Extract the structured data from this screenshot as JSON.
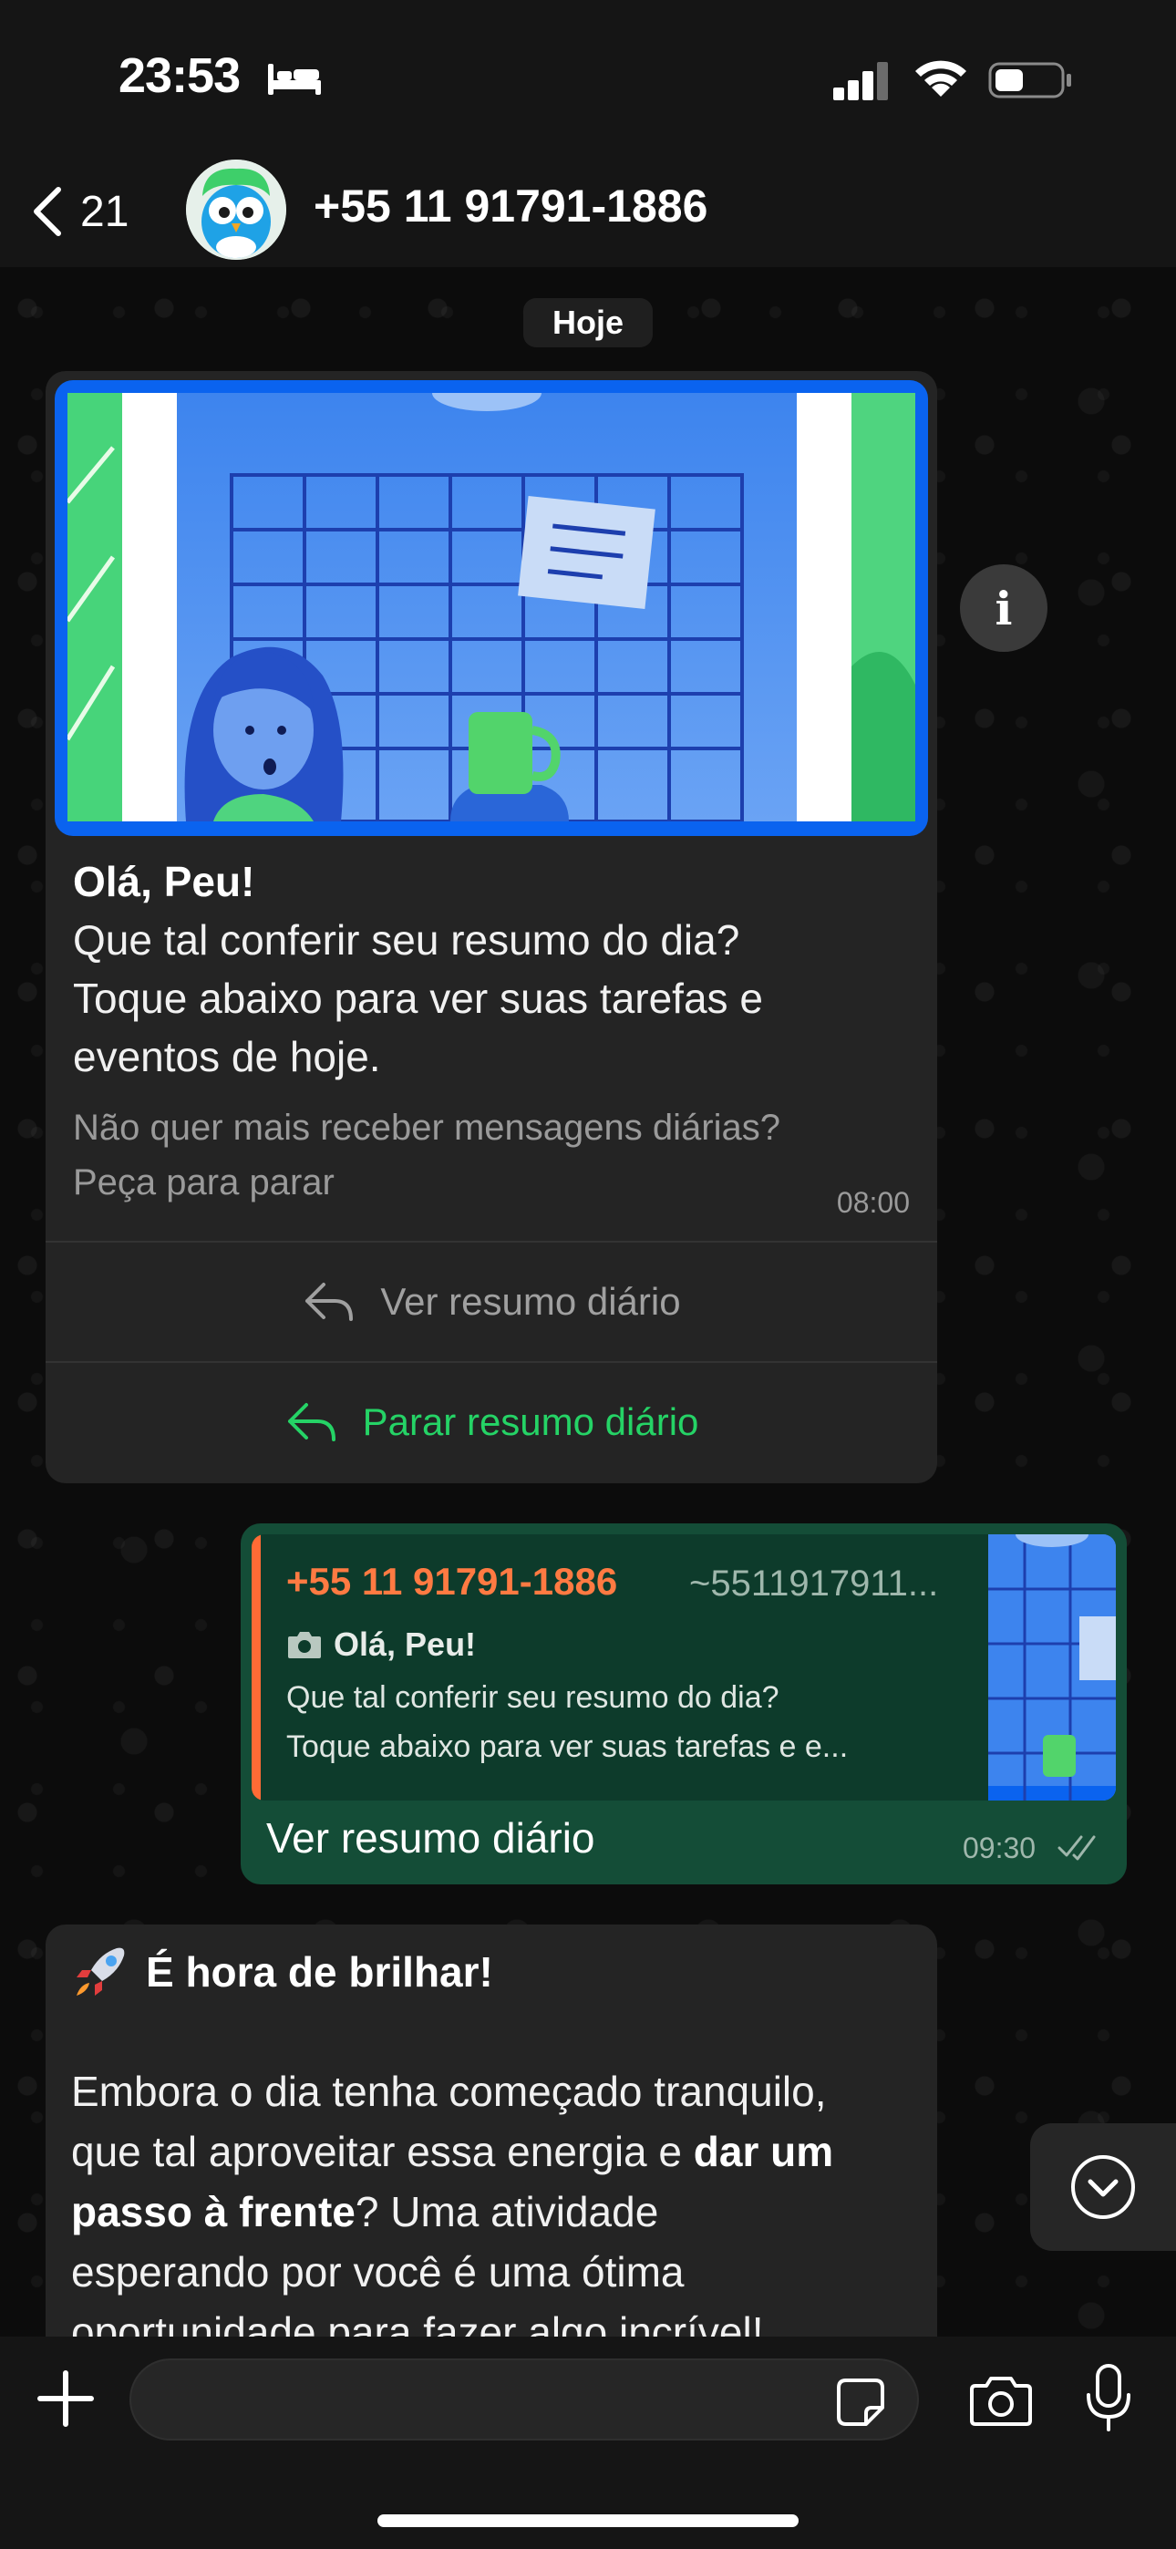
{
  "status_bar": {
    "time": "23:53",
    "icons": [
      "bed-icon",
      "signal-icon",
      "wifi-icon",
      "battery-icon"
    ]
  },
  "header": {
    "back_count": "21",
    "contact_name": "+55 11 91791-1886",
    "icons": [
      "chevron-left-icon",
      "avatar"
    ]
  },
  "chat": {
    "date_label": "Hoje",
    "template_message": {
      "greeting": "Olá, Peu!",
      "body_lines": [
        "Que tal conferir seu resumo do dia?",
        "Toque abaixo para ver suas tarefas e",
        "eventos de hoje."
      ],
      "footer_lines": [
        "Não quer mais receber mensagens diárias?",
        "Peça para parar"
      ],
      "time": "08:00",
      "buttons": [
        {
          "label": "Ver resumo diário",
          "color": "#a0a0a0"
        },
        {
          "label": "Parar resumo diário",
          "color": "#25d366"
        }
      ]
    },
    "reply_message": {
      "quote_sender": "+55 11 91791-1886",
      "quote_alias": "~5511917911...",
      "quote_title": "Olá, Peu!",
      "quote_lines": [
        "Que tal conferir seu resumo do dia?",
        "Toque abaixo para ver suas tarefas e e..."
      ],
      "text": "Ver resumo diário",
      "time": "09:30",
      "status": "read"
    },
    "third_message": {
      "title": "É hora de brilhar!",
      "lines": [
        "Embora o dia tenha começado tranquilo,",
        "que tal aproveitar essa energia e ",
        "dar um",
        "passo à frente",
        "? Uma atividade",
        "esperando por você é uma ótima",
        "oportunidade para fazer algo incrível!"
      ]
    }
  },
  "input_bar": {
    "placeholder": "",
    "icons": [
      "plus-icon",
      "sticker-icon",
      "camera-icon",
      "mic-icon"
    ]
  },
  "colors": {
    "accent_green": "#25d366",
    "outgoing_bubble": "#144d37",
    "incoming_bubble": "#242424",
    "quote_sender": "#ff7a42",
    "image_frame": "#0a63ef"
  }
}
